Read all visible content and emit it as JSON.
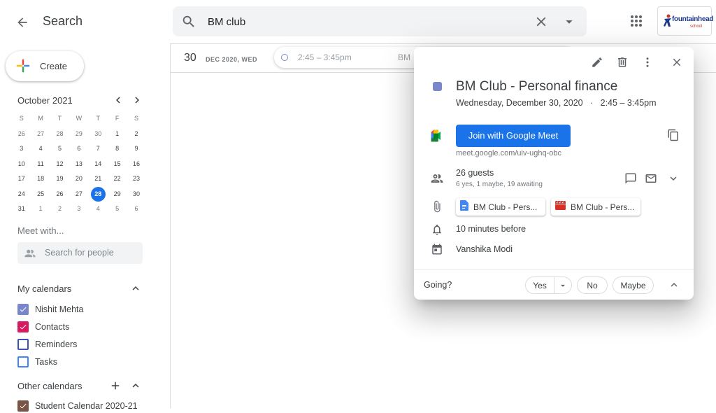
{
  "header": {
    "title": "Search",
    "search_value": "BM club",
    "logo_text": "fountainhead",
    "logo_sub": "school"
  },
  "sidebar": {
    "create_label": "Create",
    "month_title": "October 2021",
    "weekdays": [
      "S",
      "M",
      "T",
      "W",
      "T",
      "F",
      "S"
    ],
    "weeks": [
      [
        "26",
        "27",
        "28",
        "29",
        "30",
        "1",
        "2"
      ],
      [
        "3",
        "4",
        "5",
        "6",
        "7",
        "8",
        "9"
      ],
      [
        "10",
        "11",
        "12",
        "13",
        "14",
        "15",
        "16"
      ],
      [
        "17",
        "18",
        "19",
        "20",
        "21",
        "22",
        "23"
      ],
      [
        "24",
        "25",
        "26",
        "27",
        "28",
        "29",
        "30"
      ],
      [
        "31",
        "1",
        "2",
        "3",
        "4",
        "5",
        "6"
      ]
    ],
    "today": "28",
    "meet_with": "Meet with...",
    "people_placeholder": "Search for people",
    "my_calendars_title": "My calendars",
    "my_calendars": [
      {
        "label": "Nishit Mehta",
        "color": "#7986cb",
        "checked": true
      },
      {
        "label": "Contacts",
        "color": "#d81b60",
        "checked": true
      },
      {
        "label": "Reminders",
        "color": "#3f51b5",
        "checked": false
      },
      {
        "label": "Tasks",
        "color": "#4285f4",
        "checked": false
      }
    ],
    "other_calendars_title": "Other calendars",
    "other_calendars": [
      {
        "label": "Student Calendar 2020-21",
        "color": "#795548",
        "checked": true
      }
    ]
  },
  "main": {
    "day_num": "30",
    "day_date": "DEC 2020, WED",
    "event_time": "2:45 – 3:45pm",
    "event_name_partial": "BM"
  },
  "popup": {
    "title": "BM Club - Personal finance",
    "when_date": "Wednesday, December 30, 2020",
    "when_time": "2:45 – 3:45pm",
    "join_label": "Join with Google Meet",
    "meet_link": "meet.google.com/uiv-ughq-obc",
    "guests_count": "26 guests",
    "guests_status": "6 yes, 1 maybe, 19 awaiting",
    "attachments": [
      "BM Club - Pers...",
      "BM Club - Pers..."
    ],
    "reminder": "10 minutes before",
    "organizer": "Vanshika Modi",
    "going_label": "Going?",
    "rsvp_yes": "Yes",
    "rsvp_no": "No",
    "rsvp_maybe": "Maybe",
    "calendar_color": "#7986cb"
  },
  "colors": {
    "accent": "#1a73e8"
  }
}
